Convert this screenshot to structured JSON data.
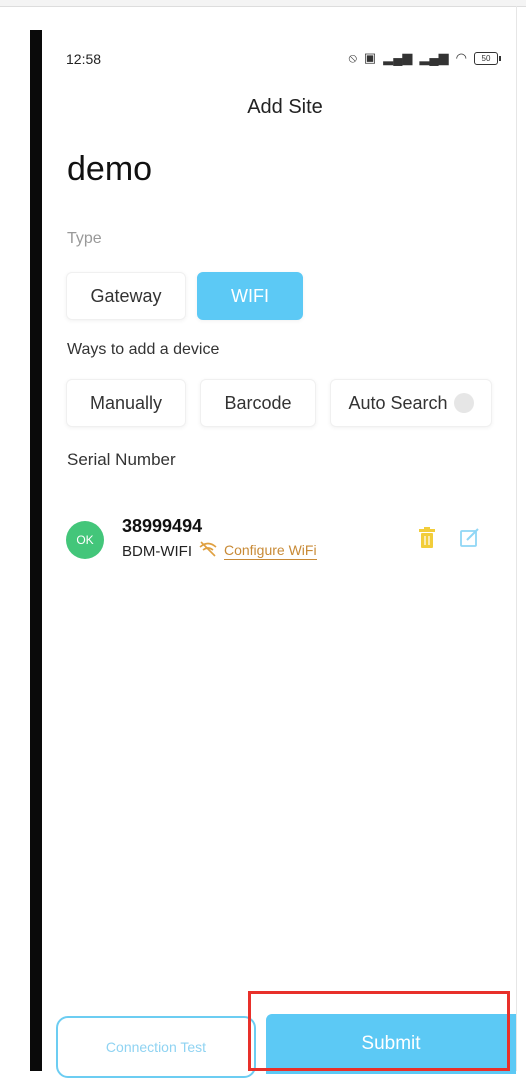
{
  "status_bar": {
    "time": "12:58",
    "battery": "50"
  },
  "header": {
    "title": "Add Site"
  },
  "site": {
    "name": "demo"
  },
  "type_section": {
    "label": "Type",
    "options": [
      "Gateway",
      "WIFI"
    ],
    "selected": "WIFI"
  },
  "ways_section": {
    "label": "Ways to add a device",
    "options": [
      "Manually",
      "Barcode",
      "Auto Search"
    ]
  },
  "serial_section": {
    "label": "Serial Number"
  },
  "device": {
    "status": "OK",
    "serial": "38999494",
    "model": "BDM-WIFI",
    "configure_label": "Configure WiFi"
  },
  "footer": {
    "connection_test_label": "Connection Test",
    "submit_label": "Submit"
  },
  "colors": {
    "accent": "#5cc9f5",
    "ok": "#43c67a",
    "link": "#c88a36",
    "highlight": "#e8302a"
  }
}
